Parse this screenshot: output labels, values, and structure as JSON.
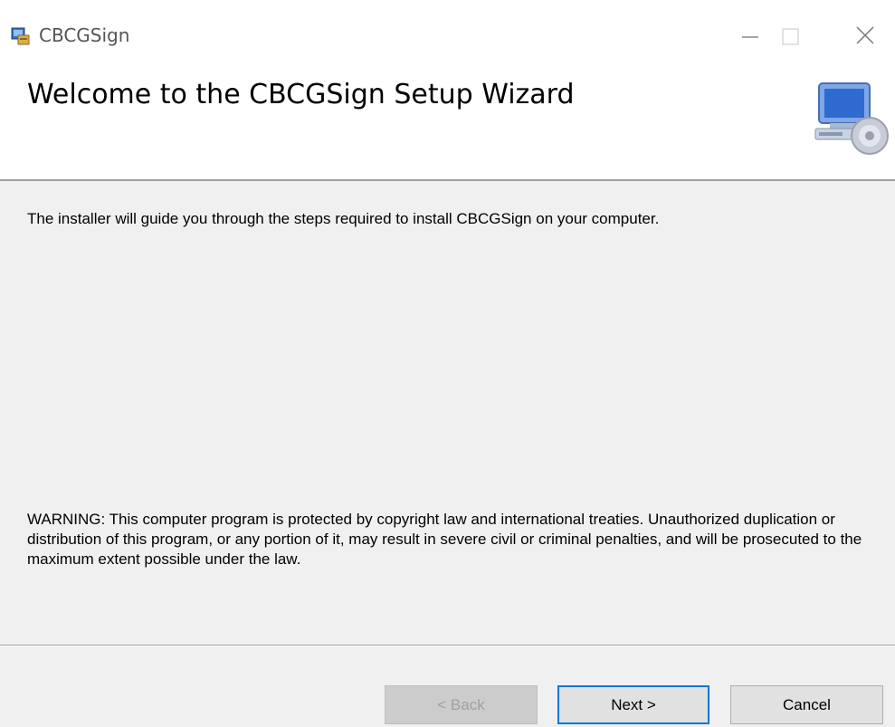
{
  "window": {
    "title": "CBCGSign",
    "controls": {
      "minimize": "minimize-icon",
      "maximize": "maximize-icon",
      "close": "close-icon"
    }
  },
  "header": {
    "title": "Welcome to the CBCGSign Setup Wizard",
    "icon": "computer-disc-icon"
  },
  "content": {
    "intro": "The installer will guide you through the steps required to install CBCGSign on your computer.",
    "warning": "WARNING: This computer program is protected by copyright law and international treaties. Unauthorized duplication or distribution of this program, or any portion of it, may result in severe civil or criminal penalties, and will be prosecuted to the maximum extent possible under the law."
  },
  "buttons": {
    "back": "< Back",
    "next": "Next >",
    "cancel": "Cancel"
  },
  "colors": {
    "accent": "#0078d7",
    "panel": "#f0f0f0",
    "header": "#ffffff"
  }
}
